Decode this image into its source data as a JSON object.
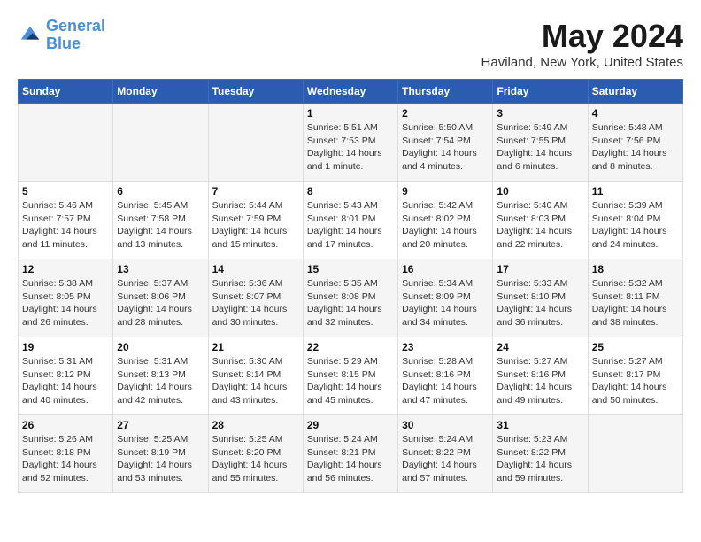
{
  "header": {
    "logo_line1": "General",
    "logo_line2": "Blue",
    "month": "May 2024",
    "location": "Haviland, New York, United States"
  },
  "weekdays": [
    "Sunday",
    "Monday",
    "Tuesday",
    "Wednesday",
    "Thursday",
    "Friday",
    "Saturday"
  ],
  "weeks": [
    [
      {
        "day": "",
        "sunrise": "",
        "sunset": "",
        "daylight": ""
      },
      {
        "day": "",
        "sunrise": "",
        "sunset": "",
        "daylight": ""
      },
      {
        "day": "",
        "sunrise": "",
        "sunset": "",
        "daylight": ""
      },
      {
        "day": "1",
        "sunrise": "Sunrise: 5:51 AM",
        "sunset": "Sunset: 7:53 PM",
        "daylight": "Daylight: 14 hours and 1 minute."
      },
      {
        "day": "2",
        "sunrise": "Sunrise: 5:50 AM",
        "sunset": "Sunset: 7:54 PM",
        "daylight": "Daylight: 14 hours and 4 minutes."
      },
      {
        "day": "3",
        "sunrise": "Sunrise: 5:49 AM",
        "sunset": "Sunset: 7:55 PM",
        "daylight": "Daylight: 14 hours and 6 minutes."
      },
      {
        "day": "4",
        "sunrise": "Sunrise: 5:48 AM",
        "sunset": "Sunset: 7:56 PM",
        "daylight": "Daylight: 14 hours and 8 minutes."
      }
    ],
    [
      {
        "day": "5",
        "sunrise": "Sunrise: 5:46 AM",
        "sunset": "Sunset: 7:57 PM",
        "daylight": "Daylight: 14 hours and 11 minutes."
      },
      {
        "day": "6",
        "sunrise": "Sunrise: 5:45 AM",
        "sunset": "Sunset: 7:58 PM",
        "daylight": "Daylight: 14 hours and 13 minutes."
      },
      {
        "day": "7",
        "sunrise": "Sunrise: 5:44 AM",
        "sunset": "Sunset: 7:59 PM",
        "daylight": "Daylight: 14 hours and 15 minutes."
      },
      {
        "day": "8",
        "sunrise": "Sunrise: 5:43 AM",
        "sunset": "Sunset: 8:01 PM",
        "daylight": "Daylight: 14 hours and 17 minutes."
      },
      {
        "day": "9",
        "sunrise": "Sunrise: 5:42 AM",
        "sunset": "Sunset: 8:02 PM",
        "daylight": "Daylight: 14 hours and 20 minutes."
      },
      {
        "day": "10",
        "sunrise": "Sunrise: 5:40 AM",
        "sunset": "Sunset: 8:03 PM",
        "daylight": "Daylight: 14 hours and 22 minutes."
      },
      {
        "day": "11",
        "sunrise": "Sunrise: 5:39 AM",
        "sunset": "Sunset: 8:04 PM",
        "daylight": "Daylight: 14 hours and 24 minutes."
      }
    ],
    [
      {
        "day": "12",
        "sunrise": "Sunrise: 5:38 AM",
        "sunset": "Sunset: 8:05 PM",
        "daylight": "Daylight: 14 hours and 26 minutes."
      },
      {
        "day": "13",
        "sunrise": "Sunrise: 5:37 AM",
        "sunset": "Sunset: 8:06 PM",
        "daylight": "Daylight: 14 hours and 28 minutes."
      },
      {
        "day": "14",
        "sunrise": "Sunrise: 5:36 AM",
        "sunset": "Sunset: 8:07 PM",
        "daylight": "Daylight: 14 hours and 30 minutes."
      },
      {
        "day": "15",
        "sunrise": "Sunrise: 5:35 AM",
        "sunset": "Sunset: 8:08 PM",
        "daylight": "Daylight: 14 hours and 32 minutes."
      },
      {
        "day": "16",
        "sunrise": "Sunrise: 5:34 AM",
        "sunset": "Sunset: 8:09 PM",
        "daylight": "Daylight: 14 hours and 34 minutes."
      },
      {
        "day": "17",
        "sunrise": "Sunrise: 5:33 AM",
        "sunset": "Sunset: 8:10 PM",
        "daylight": "Daylight: 14 hours and 36 minutes."
      },
      {
        "day": "18",
        "sunrise": "Sunrise: 5:32 AM",
        "sunset": "Sunset: 8:11 PM",
        "daylight": "Daylight: 14 hours and 38 minutes."
      }
    ],
    [
      {
        "day": "19",
        "sunrise": "Sunrise: 5:31 AM",
        "sunset": "Sunset: 8:12 PM",
        "daylight": "Daylight: 14 hours and 40 minutes."
      },
      {
        "day": "20",
        "sunrise": "Sunrise: 5:31 AM",
        "sunset": "Sunset: 8:13 PM",
        "daylight": "Daylight: 14 hours and 42 minutes."
      },
      {
        "day": "21",
        "sunrise": "Sunrise: 5:30 AM",
        "sunset": "Sunset: 8:14 PM",
        "daylight": "Daylight: 14 hours and 43 minutes."
      },
      {
        "day": "22",
        "sunrise": "Sunrise: 5:29 AM",
        "sunset": "Sunset: 8:15 PM",
        "daylight": "Daylight: 14 hours and 45 minutes."
      },
      {
        "day": "23",
        "sunrise": "Sunrise: 5:28 AM",
        "sunset": "Sunset: 8:16 PM",
        "daylight": "Daylight: 14 hours and 47 minutes."
      },
      {
        "day": "24",
        "sunrise": "Sunrise: 5:27 AM",
        "sunset": "Sunset: 8:16 PM",
        "daylight": "Daylight: 14 hours and 49 minutes."
      },
      {
        "day": "25",
        "sunrise": "Sunrise: 5:27 AM",
        "sunset": "Sunset: 8:17 PM",
        "daylight": "Daylight: 14 hours and 50 minutes."
      }
    ],
    [
      {
        "day": "26",
        "sunrise": "Sunrise: 5:26 AM",
        "sunset": "Sunset: 8:18 PM",
        "daylight": "Daylight: 14 hours and 52 minutes."
      },
      {
        "day": "27",
        "sunrise": "Sunrise: 5:25 AM",
        "sunset": "Sunset: 8:19 PM",
        "daylight": "Daylight: 14 hours and 53 minutes."
      },
      {
        "day": "28",
        "sunrise": "Sunrise: 5:25 AM",
        "sunset": "Sunset: 8:20 PM",
        "daylight": "Daylight: 14 hours and 55 minutes."
      },
      {
        "day": "29",
        "sunrise": "Sunrise: 5:24 AM",
        "sunset": "Sunset: 8:21 PM",
        "daylight": "Daylight: 14 hours and 56 minutes."
      },
      {
        "day": "30",
        "sunrise": "Sunrise: 5:24 AM",
        "sunset": "Sunset: 8:22 PM",
        "daylight": "Daylight: 14 hours and 57 minutes."
      },
      {
        "day": "31",
        "sunrise": "Sunrise: 5:23 AM",
        "sunset": "Sunset: 8:22 PM",
        "daylight": "Daylight: 14 hours and 59 minutes."
      },
      {
        "day": "",
        "sunrise": "",
        "sunset": "",
        "daylight": ""
      }
    ]
  ]
}
